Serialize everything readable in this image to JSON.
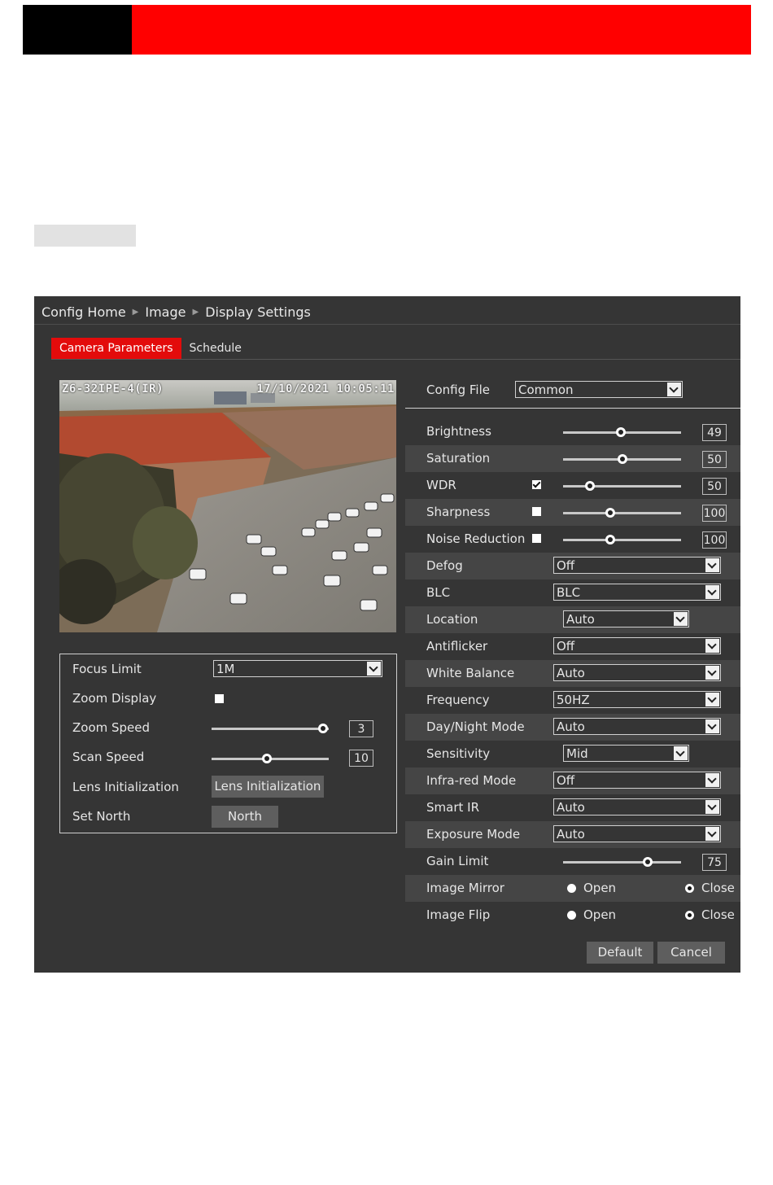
{
  "breadcrumb": [
    "Config Home",
    "Image",
    "Display Settings"
  ],
  "tabs": [
    "Camera Parameters",
    "Schedule"
  ],
  "preview": {
    "osd_left": "Z6-32IPE-4(IR)",
    "osd_right": "17/10/2021 10:05:11"
  },
  "lens": {
    "focus_limit": {
      "label": "Focus Limit",
      "value": "1M"
    },
    "zoom_display": {
      "label": "Zoom Display",
      "checked": false
    },
    "zoom_speed": {
      "label": "Zoom Speed",
      "value": "3",
      "fraction": 0.95
    },
    "scan_speed": {
      "label": "Scan Speed",
      "value": "10",
      "fraction": 0.47
    },
    "lens_init": {
      "label": "Lens Initialization",
      "button": "Lens Initialization"
    },
    "set_north": {
      "label": "Set North",
      "button": "North"
    }
  },
  "config": {
    "file_label": "Config File",
    "file_value": "Common",
    "rows": {
      "brightness": {
        "label": "Brightness",
        "value": "49",
        "fraction": 0.49
      },
      "saturation": {
        "label": "Saturation",
        "value": "50",
        "fraction": 0.5
      },
      "wdr": {
        "label": "WDR",
        "value": "50",
        "checked": true,
        "fraction": 0.23
      },
      "sharpness": {
        "label": "Sharpness",
        "value": "100",
        "checked": false,
        "fraction": 0.4
      },
      "noise_reduction": {
        "label": "Noise Reduction",
        "value": "100",
        "checked": false,
        "fraction": 0.4
      },
      "defog": {
        "label": "Defog",
        "value": "Off"
      },
      "blc": {
        "label": "BLC",
        "value": "BLC"
      },
      "location": {
        "label": "Location",
        "value": "Auto"
      },
      "antiflicker": {
        "label": "Antiflicker",
        "value": "Off"
      },
      "white_balance": {
        "label": "White Balance",
        "value": "Auto"
      },
      "frequency": {
        "label": "Frequency",
        "value": "50HZ"
      },
      "day_night": {
        "label": "Day/Night Mode",
        "value": "Auto"
      },
      "sensitivity": {
        "label": "Sensitivity",
        "value": "Mid"
      },
      "infrared": {
        "label": "Infra-red Mode",
        "value": "Off"
      },
      "smart_ir": {
        "label": "Smart IR",
        "value": "Auto"
      },
      "exposure": {
        "label": "Exposure Mode",
        "value": "Auto"
      },
      "gain_limit": {
        "label": "Gain Limit",
        "value": "75",
        "fraction": 0.72
      },
      "image_mirror": {
        "label": "Image Mirror",
        "open": "Open",
        "close": "Close",
        "selected": "Close"
      },
      "image_flip": {
        "label": "Image Flip",
        "open": "Open",
        "close": "Close",
        "selected": "Close"
      }
    }
  },
  "buttons": {
    "default": "Default",
    "cancel": "Cancel"
  },
  "colors": {
    "header_red": "#ff0000",
    "tab_active": "#e30b0b",
    "panel_bg": "#353535",
    "row_alt": "#454545"
  }
}
